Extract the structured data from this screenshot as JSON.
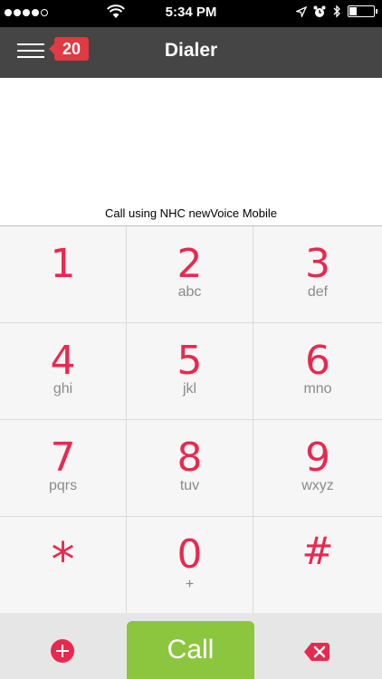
{
  "status_bar": {
    "time": "5:34 PM",
    "signal_filled": 4,
    "signal_total": 5,
    "battery_level": 0.3
  },
  "nav": {
    "title": "Dialer",
    "badge_count": "20"
  },
  "call_using_text": "Call using NHC newVoice Mobile",
  "keypad": [
    {
      "digit": "1",
      "letters": ""
    },
    {
      "digit": "2",
      "letters": "abc"
    },
    {
      "digit": "3",
      "letters": "def"
    },
    {
      "digit": "4",
      "letters": "ghi"
    },
    {
      "digit": "5",
      "letters": "jkl"
    },
    {
      "digit": "6",
      "letters": "mno"
    },
    {
      "digit": "7",
      "letters": "pqrs"
    },
    {
      "digit": "8",
      "letters": "tuv"
    },
    {
      "digit": "9",
      "letters": "wxyz"
    },
    {
      "digit": "*",
      "letters": ""
    },
    {
      "digit": "0",
      "letters": "+"
    },
    {
      "digit": "#",
      "letters": ""
    }
  ],
  "bottom_bar": {
    "call_label": "Call",
    "add_icon": "plus-circle-icon",
    "delete_icon": "backspace-icon"
  },
  "colors": {
    "accent": "#e8294f",
    "call_green": "#8cc63f",
    "navbar": "#454545"
  }
}
